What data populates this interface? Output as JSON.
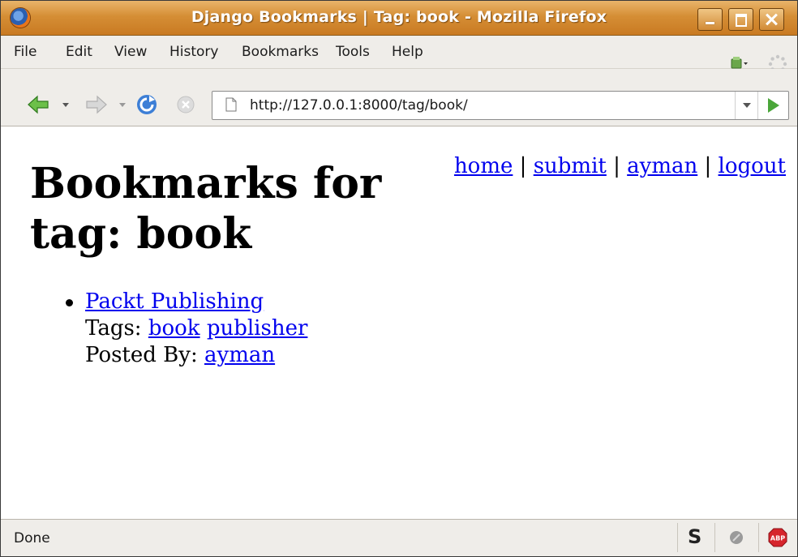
{
  "window": {
    "title": "Django Bookmarks | Tag: book - Mozilla Firefox"
  },
  "menubar": {
    "items": [
      "File",
      "Edit",
      "View",
      "History",
      "Bookmarks",
      "Tools",
      "Help"
    ]
  },
  "navigation": {
    "url": "http://127.0.0.1:8000/tag/book/"
  },
  "page": {
    "heading": "Bookmarks for tag: book",
    "nav_links": [
      "home",
      "submit",
      "ayman",
      "logout"
    ],
    "nav_separator": "|",
    "bookmarks": [
      {
        "title": "Packt Publishing",
        "tags_label": "Tags:",
        "tags": [
          "book",
          "publisher"
        ],
        "posted_by_label": "Posted By:",
        "user": "ayman"
      }
    ]
  },
  "statusbar": {
    "text": "Done",
    "icons": [
      "sync-s-icon",
      "disabled-circle-icon",
      "adblock-plus-icon"
    ],
    "adblock_label": "ABP"
  },
  "colors": {
    "titlebar": "#d58e35",
    "link": "#0000ee",
    "toolbar_bg": "#efede9"
  }
}
